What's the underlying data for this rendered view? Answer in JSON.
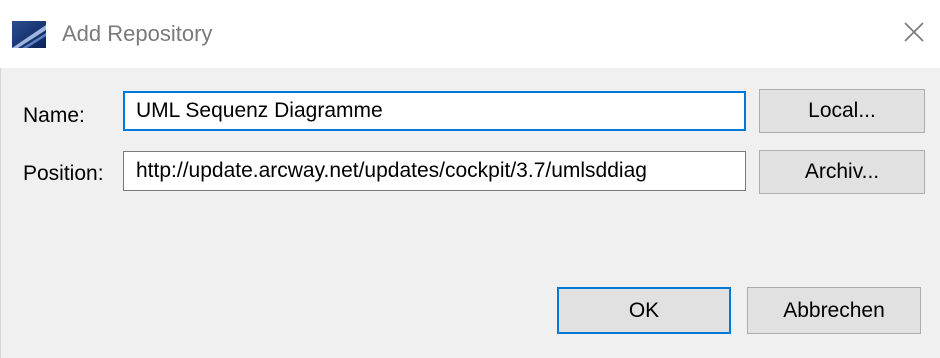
{
  "window": {
    "title": "Add Repository"
  },
  "form": {
    "name_label": "Name:",
    "name_value": "UML Sequenz Diagramme",
    "position_label": "Position:",
    "position_value": "http://update.arcway.net/updates/cockpit/3.7/umlsddiag"
  },
  "buttons": {
    "local_label": "Local...",
    "archive_label": "Archiv...",
    "ok_label": "OK",
    "cancel_label": "Abbrechen"
  },
  "colors": {
    "focus_accent": "#0078d7",
    "button_face": "#e1e1e1",
    "dialog_bg": "#f0f0f0"
  },
  "icons": {
    "app": "eclipse-window-icon",
    "close": "close-icon"
  }
}
